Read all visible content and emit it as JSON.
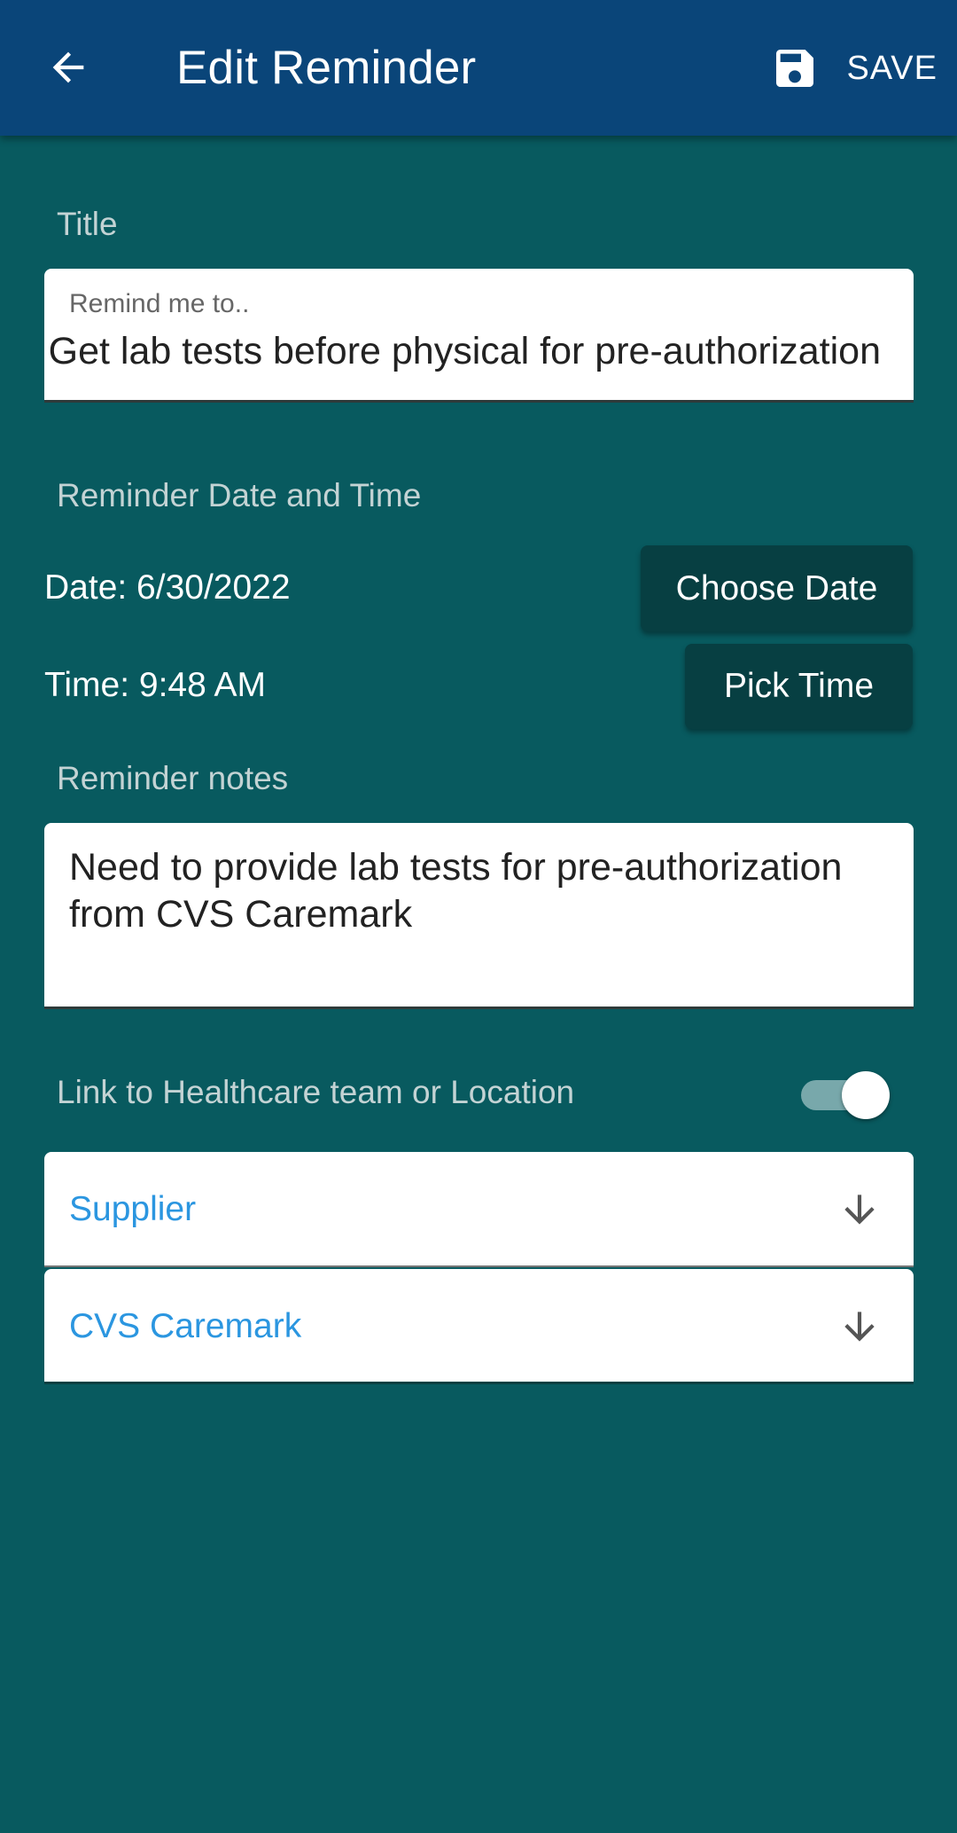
{
  "header": {
    "title": "Edit Reminder",
    "save_label": "SAVE",
    "back_icon": "arrow-back-icon",
    "save_icon": "save-icon"
  },
  "title_section": {
    "label": "Title",
    "placeholder": "Remind me to..",
    "value": "Get lab tests before physical for pre-authorization"
  },
  "datetime_section": {
    "label": "Reminder Date and Time",
    "date_text": "Date: 6/30/2022",
    "time_text": "Time: 9:48 AM",
    "choose_date_label": "Choose Date",
    "pick_time_label": "Pick Time"
  },
  "notes_section": {
    "label": "Reminder notes",
    "value": "Need to provide lab tests for pre-authorization from CVS Caremark"
  },
  "link_section": {
    "label": "Link to Healthcare team or Location",
    "toggle_on": true
  },
  "dropdowns": {
    "type_value": "Supplier",
    "provider_value": "CVS Caremark",
    "arrow_icon": "arrow-down-icon"
  },
  "colors": {
    "appbar": "#0a4579",
    "background": "#085a5f",
    "button": "#073f42",
    "link_blue": "#2b96e0"
  }
}
